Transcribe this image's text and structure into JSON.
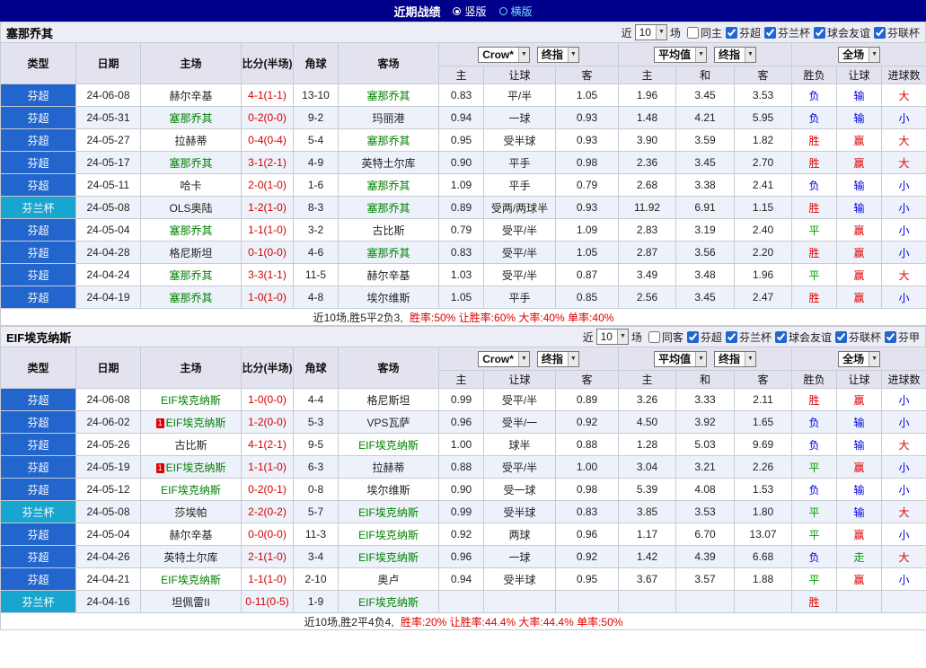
{
  "titlebar": {
    "title": "近期战绩",
    "vertical": "竖版",
    "horizontal": "横版"
  },
  "columns": {
    "type": "类型",
    "date": "日期",
    "home": "主场",
    "score": "比分(半场)",
    "corner": "角球",
    "away": "客场",
    "sub": [
      "主",
      "让球",
      "客",
      "主",
      "和",
      "客",
      "胜负",
      "让球",
      "进球数"
    ],
    "selects": {
      "bookmaker": "Crow*",
      "final": "终指",
      "average": "平均值",
      "fullmatch": "全场"
    }
  },
  "sections": [
    {
      "team": "塞那乔其",
      "controls": {
        "near": "近",
        "count": "10",
        "unit": "场",
        "checkboxes": [
          {
            "label": "同主",
            "checked": false
          },
          {
            "label": "芬超",
            "checked": true
          },
          {
            "label": "芬兰杯",
            "checked": true
          },
          {
            "label": "球会友谊",
            "checked": true
          },
          {
            "label": "芬联杯",
            "checked": true
          }
        ]
      },
      "rows": [
        {
          "league": "芬超",
          "lc": "b",
          "date": "24-06-08",
          "home": "赫尔辛基",
          "hf": false,
          "hr": false,
          "score": "4-1(1-1)",
          "corner": "13-10",
          "away": "塞那乔其",
          "af": true,
          "h1": "0.83",
          "hc": "平/半",
          "h2": "1.05",
          "e1": "1.96",
          "e2": "3.45",
          "e3": "3.53",
          "r1": "负",
          "r1c": "b",
          "r2": "输",
          "r2c": "b",
          "r3": "大",
          "r3c": "r"
        },
        {
          "league": "芬超",
          "lc": "b",
          "date": "24-05-31",
          "home": "塞那乔其",
          "hf": true,
          "hr": false,
          "score": "0-2(0-0)",
          "corner": "9-2",
          "away": "玛丽港",
          "af": false,
          "h1": "0.94",
          "hc": "一球",
          "h2": "0.93",
          "e1": "1.48",
          "e2": "4.21",
          "e3": "5.95",
          "r1": "负",
          "r1c": "b",
          "r2": "输",
          "r2c": "b",
          "r3": "小",
          "r3c": "b"
        },
        {
          "league": "芬超",
          "lc": "b",
          "date": "24-05-27",
          "home": "拉赫蒂",
          "hf": false,
          "hr": false,
          "score": "0-4(0-4)",
          "corner": "5-4",
          "away": "塞那乔其",
          "af": true,
          "h1": "0.95",
          "hc": "受半球",
          "h2": "0.93",
          "e1": "3.90",
          "e2": "3.59",
          "e3": "1.82",
          "r1": "胜",
          "r1c": "r",
          "r2": "赢",
          "r2c": "r",
          "r3": "大",
          "r3c": "r"
        },
        {
          "league": "芬超",
          "lc": "b",
          "date": "24-05-17",
          "home": "塞那乔其",
          "hf": true,
          "hr": false,
          "score": "3-1(2-1)",
          "corner": "4-9",
          "away": "英特土尔库",
          "af": false,
          "h1": "0.90",
          "hc": "平手",
          "h2": "0.98",
          "e1": "2.36",
          "e2": "3.45",
          "e3": "2.70",
          "r1": "胜",
          "r1c": "r",
          "r2": "赢",
          "r2c": "r",
          "r3": "大",
          "r3c": "r"
        },
        {
          "league": "芬超",
          "lc": "b",
          "date": "24-05-11",
          "home": "哈卡",
          "hf": false,
          "hr": false,
          "score": "2-0(1-0)",
          "corner": "1-6",
          "away": "塞那乔其",
          "af": true,
          "h1": "1.09",
          "hc": "平手",
          "h2": "0.79",
          "e1": "2.68",
          "e2": "3.38",
          "e3": "2.41",
          "r1": "负",
          "r1c": "b",
          "r2": "输",
          "r2c": "b",
          "r3": "小",
          "r3c": "b"
        },
        {
          "league": "芬兰杯",
          "lc": "c",
          "date": "24-05-08",
          "home": "OLS奥陆",
          "hf": false,
          "hr": false,
          "score": "1-2(1-0)",
          "corner": "8-3",
          "away": "塞那乔其",
          "af": true,
          "h1": "0.89",
          "hc": "受两/两球半",
          "h2": "0.93",
          "e1": "11.92",
          "e2": "6.91",
          "e3": "1.15",
          "r1": "胜",
          "r1c": "r",
          "r2": "输",
          "r2c": "b",
          "r3": "小",
          "r3c": "b"
        },
        {
          "league": "芬超",
          "lc": "b",
          "date": "24-05-04",
          "home": "塞那乔其",
          "hf": true,
          "hr": false,
          "score": "1-1(1-0)",
          "corner": "3-2",
          "away": "古比斯",
          "af": false,
          "h1": "0.79",
          "hc": "受平/半",
          "h2": "1.09",
          "e1": "2.83",
          "e2": "3.19",
          "e3": "2.40",
          "r1": "平",
          "r1c": "g",
          "r2": "赢",
          "r2c": "r",
          "r3": "小",
          "r3c": "b"
        },
        {
          "league": "芬超",
          "lc": "b",
          "date": "24-04-28",
          "home": "格尼斯坦",
          "hf": false,
          "hr": false,
          "score": "0-1(0-0)",
          "corner": "4-6",
          "away": "塞那乔其",
          "af": true,
          "h1": "0.83",
          "hc": "受平/半",
          "h2": "1.05",
          "e1": "2.87",
          "e2": "3.56",
          "e3": "2.20",
          "r1": "胜",
          "r1c": "r",
          "r2": "赢",
          "r2c": "r",
          "r3": "小",
          "r3c": "b"
        },
        {
          "league": "芬超",
          "lc": "b",
          "date": "24-04-24",
          "home": "塞那乔其",
          "hf": true,
          "hr": false,
          "score": "3-3(1-1)",
          "corner": "11-5",
          "away": "赫尔辛基",
          "af": false,
          "h1": "1.03",
          "hc": "受平/半",
          "h2": "0.87",
          "e1": "3.49",
          "e2": "3.48",
          "e3": "1.96",
          "r1": "平",
          "r1c": "g",
          "r2": "赢",
          "r2c": "r",
          "r3": "大",
          "r3c": "r"
        },
        {
          "league": "芬超",
          "lc": "b",
          "date": "24-04-19",
          "home": "塞那乔其",
          "hf": true,
          "hr": false,
          "score": "1-0(1-0)",
          "corner": "4-8",
          "away": "埃尔维斯",
          "af": false,
          "h1": "1.05",
          "hc": "平手",
          "h2": "0.85",
          "e1": "2.56",
          "e2": "3.45",
          "e3": "2.47",
          "r1": "胜",
          "r1c": "r",
          "r2": "赢",
          "r2c": "r",
          "r3": "小",
          "r3c": "b"
        }
      ],
      "footer": {
        "prefix": "近10场,胜5平2负3,",
        "stats": "胜率:50% 让胜率:60% 大率:40% 单率:40%"
      }
    },
    {
      "team": "EIF埃克纳斯",
      "controls": {
        "near": "近",
        "count": "10",
        "unit": "场",
        "checkboxes": [
          {
            "label": "同客",
            "checked": false
          },
          {
            "label": "芬超",
            "checked": true
          },
          {
            "label": "芬兰杯",
            "checked": true
          },
          {
            "label": "球会友谊",
            "checked": true
          },
          {
            "label": "芬联杯",
            "checked": true
          },
          {
            "label": "芬甲",
            "checked": true
          }
        ]
      },
      "rows": [
        {
          "league": "芬超",
          "lc": "b",
          "date": "24-06-08",
          "home": "EIF埃克纳斯",
          "hf": true,
          "hr": false,
          "score": "1-0(0-0)",
          "corner": "4-4",
          "away": "格尼斯坦",
          "af": false,
          "h1": "0.99",
          "hc": "受平/半",
          "h2": "0.89",
          "e1": "3.26",
          "e2": "3.33",
          "e3": "2.11",
          "r1": "胜",
          "r1c": "r",
          "r2": "赢",
          "r2c": "r",
          "r3": "小",
          "r3c": "b"
        },
        {
          "league": "芬超",
          "lc": "b",
          "date": "24-06-02",
          "home": "EIF埃克纳斯",
          "hf": true,
          "hr": true,
          "score": "1-2(0-0)",
          "corner": "5-3",
          "away": "VPS瓦萨",
          "af": false,
          "h1": "0.96",
          "hc": "受半/一",
          "h2": "0.92",
          "e1": "4.50",
          "e2": "3.92",
          "e3": "1.65",
          "r1": "负",
          "r1c": "b",
          "r2": "输",
          "r2c": "b",
          "r3": "小",
          "r3c": "b"
        },
        {
          "league": "芬超",
          "lc": "b",
          "date": "24-05-26",
          "home": "古比斯",
          "hf": false,
          "hr": false,
          "score": "4-1(2-1)",
          "corner": "9-5",
          "away": "EIF埃克纳斯",
          "af": true,
          "h1": "1.00",
          "hc": "球半",
          "h2": "0.88",
          "e1": "1.28",
          "e2": "5.03",
          "e3": "9.69",
          "r1": "负",
          "r1c": "b",
          "r2": "输",
          "r2c": "b",
          "r3": "大",
          "r3c": "r"
        },
        {
          "league": "芬超",
          "lc": "b",
          "date": "24-05-19",
          "home": "EIF埃克纳斯",
          "hf": true,
          "hr": true,
          "score": "1-1(1-0)",
          "corner": "6-3",
          "away": "拉赫蒂",
          "af": false,
          "h1": "0.88",
          "hc": "受平/半",
          "h2": "1.00",
          "e1": "3.04",
          "e2": "3.21",
          "e3": "2.26",
          "r1": "平",
          "r1c": "g",
          "r2": "赢",
          "r2c": "r",
          "r3": "小",
          "r3c": "b"
        },
        {
          "league": "芬超",
          "lc": "b",
          "date": "24-05-12",
          "home": "EIF埃克纳斯",
          "hf": true,
          "hr": false,
          "score": "0-2(0-1)",
          "corner": "0-8",
          "away": "埃尔维斯",
          "af": false,
          "h1": "0.90",
          "hc": "受一球",
          "h2": "0.98",
          "e1": "5.39",
          "e2": "4.08",
          "e3": "1.53",
          "r1": "负",
          "r1c": "b",
          "r2": "输",
          "r2c": "b",
          "r3": "小",
          "r3c": "b"
        },
        {
          "league": "芬兰杯",
          "lc": "c",
          "date": "24-05-08",
          "home": "莎埃帕",
          "hf": false,
          "hr": false,
          "score": "2-2(0-2)",
          "corner": "5-7",
          "away": "EIF埃克纳斯",
          "af": true,
          "h1": "0.99",
          "hc": "受半球",
          "h2": "0.83",
          "e1": "3.85",
          "e2": "3.53",
          "e3": "1.80",
          "r1": "平",
          "r1c": "g",
          "r2": "输",
          "r2c": "b",
          "r3": "大",
          "r3c": "r"
        },
        {
          "league": "芬超",
          "lc": "b",
          "date": "24-05-04",
          "home": "赫尔辛基",
          "hf": false,
          "hr": false,
          "score": "0-0(0-0)",
          "corner": "11-3",
          "away": "EIF埃克纳斯",
          "af": true,
          "h1": "0.92",
          "hc": "两球",
          "h2": "0.96",
          "e1": "1.17",
          "e2": "6.70",
          "e3": "13.07",
          "r1": "平",
          "r1c": "g",
          "r2": "赢",
          "r2c": "r",
          "r3": "小",
          "r3c": "b"
        },
        {
          "league": "芬超",
          "lc": "b",
          "date": "24-04-26",
          "home": "英特土尔库",
          "hf": false,
          "hr": false,
          "score": "2-1(1-0)",
          "corner": "3-4",
          "away": "EIF埃克纳斯",
          "af": true,
          "h1": "0.96",
          "hc": "一球",
          "h2": "0.92",
          "e1": "1.42",
          "e2": "4.39",
          "e3": "6.68",
          "r1": "负",
          "r1c": "b",
          "r2": "走",
          "r2c": "g",
          "r3": "大",
          "r3c": "r"
        },
        {
          "league": "芬超",
          "lc": "b",
          "date": "24-04-21",
          "home": "EIF埃克纳斯",
          "hf": true,
          "hr": false,
          "score": "1-1(1-0)",
          "corner": "2-10",
          "away": "奥卢",
          "af": false,
          "h1": "0.94",
          "hc": "受半球",
          "h2": "0.95",
          "e1": "3.67",
          "e2": "3.57",
          "e3": "1.88",
          "r1": "平",
          "r1c": "g",
          "r2": "赢",
          "r2c": "r",
          "r3": "小",
          "r3c": "b"
        },
        {
          "league": "芬兰杯",
          "lc": "c",
          "date": "24-04-16",
          "home": "坦佩雷II",
          "hf": false,
          "hr": false,
          "score": "0-11(0-5)",
          "corner": "1-9",
          "away": "EIF埃克纳斯",
          "af": true,
          "h1": "",
          "hc": "",
          "h2": "",
          "e1": "",
          "e2": "",
          "e3": "",
          "r1": "胜",
          "r1c": "r",
          "r2": "",
          "r2c": "",
          "r3": "",
          "r3c": ""
        }
      ],
      "footer": {
        "prefix": "近10场,胜2平4负4,",
        "stats": "胜率:20% 让胜率:44.4% 大率:44.4% 单率:50%"
      }
    }
  ]
}
